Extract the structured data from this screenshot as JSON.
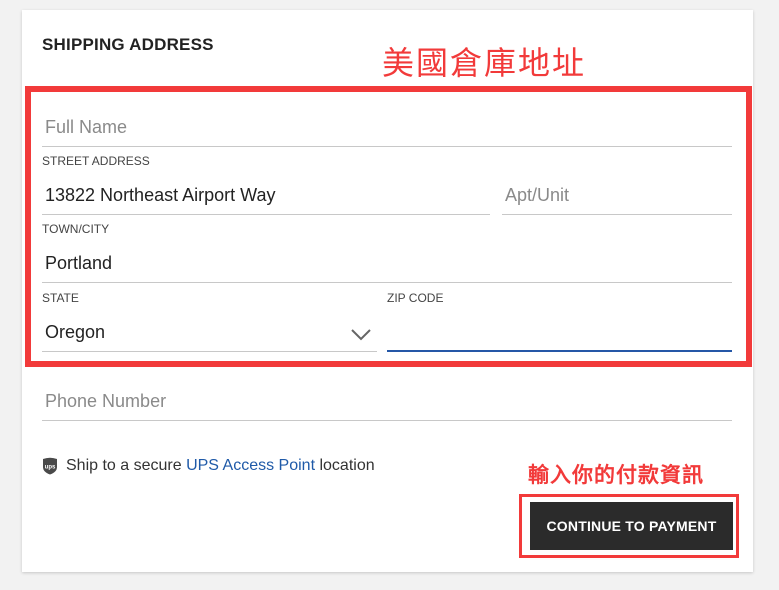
{
  "form": {
    "section_title": "SHIPPING ADDRESS",
    "full_name": {
      "placeholder": "Full Name",
      "value": ""
    },
    "street_address": {
      "label": "STREET ADDRESS",
      "value": "13822 Northeast Airport Way"
    },
    "apt_unit": {
      "placeholder": "Apt/Unit",
      "value": ""
    },
    "town_city": {
      "label": "TOWN/CITY",
      "value": "Portland"
    },
    "state": {
      "label": "STATE",
      "value": "Oregon",
      "icon": "chevron-down-icon"
    },
    "zip_code": {
      "label": "ZIP CODE",
      "value": ""
    },
    "phone_number": {
      "placeholder": "Phone Number",
      "value": ""
    }
  },
  "ups": {
    "icon": "ups-shield-icon",
    "prefix": "Ship to a secure ",
    "link_text": "UPS Access Point",
    "suffix": " location"
  },
  "continue_button": {
    "label": "CONTINUE TO PAYMENT"
  },
  "annotations": {
    "top": "美國倉庫地址",
    "bottom": "輸入你的付款資訊",
    "color": "#f23a3a"
  },
  "colors": {
    "button_bg": "#2b2b2b",
    "link": "#1f5aa8",
    "focus_underline": "#2557a7"
  }
}
